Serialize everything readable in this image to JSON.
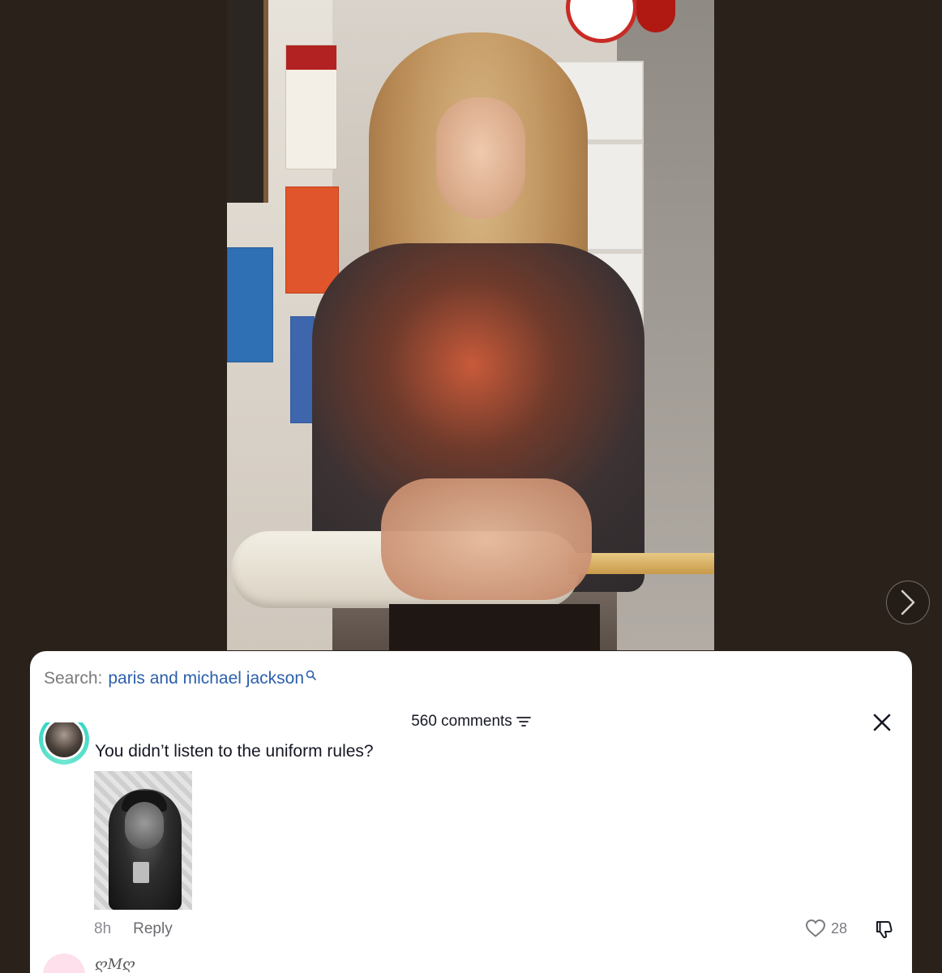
{
  "video": {
    "description_icon": "video-frame"
  },
  "navigation": {
    "next_icon": "chevron-right-icon"
  },
  "comments_panel": {
    "search": {
      "label": "Search:",
      "term": "paris and michael jackson",
      "icon": "search-icon"
    },
    "count_label": "560 comments",
    "filter_icon": "filter-icon",
    "close_icon": "close-icon",
    "comment": {
      "text": "You didn’t listen to the uniform rules?",
      "time": "8h",
      "reply_label": "Reply",
      "likes": "28"
    },
    "next_comment": {
      "username": "ღMღ"
    }
  },
  "colors": {
    "background": "#2a211b",
    "search_link": "#2b5fab",
    "avatar_ring": "#25d1c3"
  }
}
